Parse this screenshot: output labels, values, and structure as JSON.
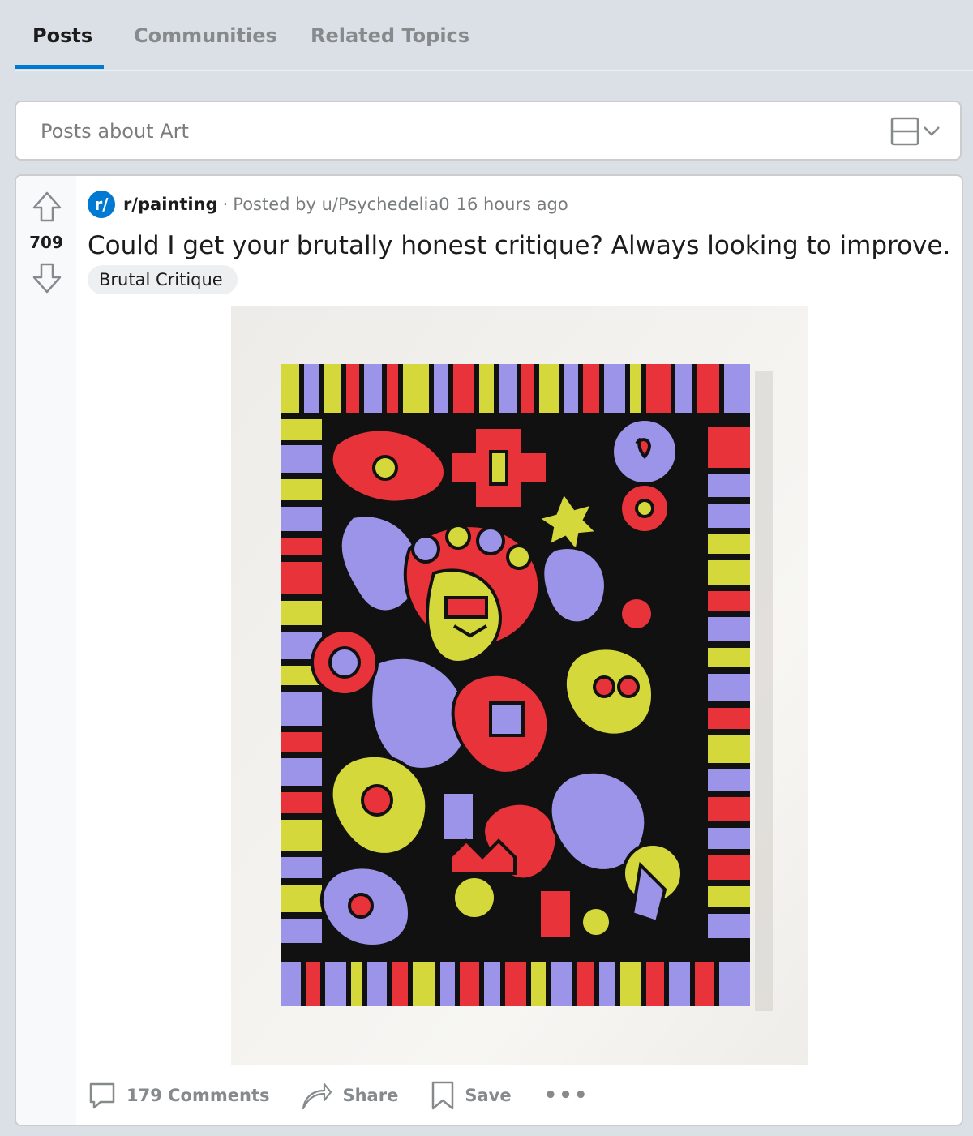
{
  "tabs": [
    {
      "label": "Posts",
      "active": true
    },
    {
      "label": "Communities",
      "active": false
    },
    {
      "label": "Related Topics",
      "active": false
    }
  ],
  "search": {
    "label": "Posts about Art"
  },
  "post": {
    "score": "709",
    "subreddit_icon": "r/",
    "subreddit": "r/painting",
    "separator": "·",
    "posted_by": "Posted by u/Psychedelia0",
    "time": "16 hours ago",
    "title": "Could I get your brutally honest critique? Always looking to improve.",
    "flair": "Brutal Critique",
    "image": {
      "description_icon": "abstract-painting-image",
      "palette": [
        "#e8333a",
        "#d4d83a",
        "#9b94e8",
        "#111111"
      ]
    },
    "actions": {
      "comments": "179 Comments",
      "share": "Share",
      "save": "Save",
      "more": "•••"
    }
  },
  "colors": {
    "accent": "#0079d3",
    "background": "#dae0e6"
  }
}
